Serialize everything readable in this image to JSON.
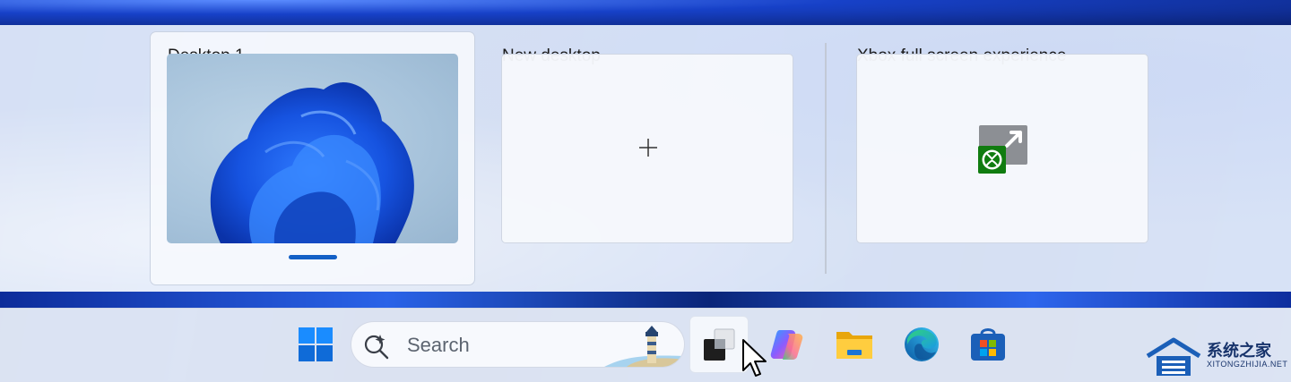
{
  "task_view": {
    "desktops": [
      {
        "title": "Desktop 1",
        "active": true
      },
      {
        "title": "New desktop"
      },
      {
        "title": "Xbox full screen experience"
      }
    ]
  },
  "taskbar": {
    "start_icon": "windows-logo-icon",
    "search": {
      "label": "Search",
      "icon": "copilot-search-icon",
      "highlight_icon": "lighthouse-icon"
    },
    "pinned": [
      "task-view-icon",
      "copilot-icon",
      "file-explorer-icon",
      "edge-icon",
      "microsoft-store-icon"
    ]
  },
  "watermark": {
    "text": "系统之家",
    "url": "XITONGZHIJIA.NET"
  },
  "colors": {
    "accent": "#1360c6",
    "panel": "#e2eaf8"
  }
}
